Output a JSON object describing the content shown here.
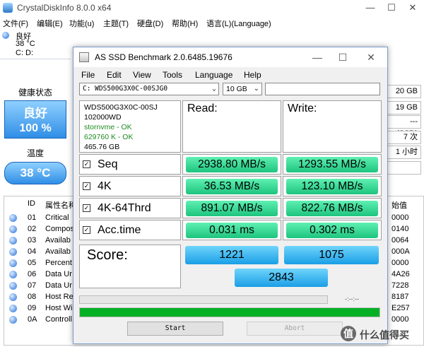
{
  "cdi": {
    "title": "CrystalDiskInfo 8.0.0 x64",
    "menu": [
      "文件(F)",
      "编辑(E)",
      "功能(u)",
      "主题(T)",
      "硬盘(D)",
      "帮助(H)",
      "语言(L)(Language)"
    ],
    "disk_tab": {
      "status": "良好",
      "temp": "38 °C",
      "letter": "C: D:"
    },
    "health_label": "健康状态",
    "health_status": "良好",
    "health_percent": "100 %",
    "temp_label": "温度",
    "temperature": "38 °C",
    "right_values": [
      "20 GB",
      "19 GB",
      "--- (SSD)",
      "7 次",
      "1 小时",
      ""
    ],
    "table": {
      "headers": {
        "id": "ID",
        "name": "属性名称",
        "raw": "始值"
      },
      "rows": [
        {
          "id": "01",
          "name": "Critical",
          "raw": "0000"
        },
        {
          "id": "02",
          "name": "Compos",
          "raw": "0140"
        },
        {
          "id": "03",
          "name": "Availab",
          "raw": "0064"
        },
        {
          "id": "04",
          "name": "Availab",
          "raw": "000A"
        },
        {
          "id": "05",
          "name": "Percent",
          "raw": "0000"
        },
        {
          "id": "06",
          "name": "Data Ur",
          "raw": "4A26"
        },
        {
          "id": "07",
          "name": "Data Ur",
          "raw": "7228"
        },
        {
          "id": "08",
          "name": "Host Re",
          "raw": "8187"
        },
        {
          "id": "09",
          "name": "Host Wi",
          "raw": "E257"
        },
        {
          "id": "0A",
          "name": "Controll",
          "raw": "0000"
        }
      ]
    }
  },
  "asssd": {
    "title": "AS SSD Benchmark 2.0.6485.19676",
    "window_buttons": {
      "minimize": "—",
      "maximize": "☐",
      "close": "✕"
    },
    "menu": [
      "File",
      "Edit",
      "View",
      "Tools",
      "Language",
      "Help"
    ],
    "drive_select": "C: WDS500G3X0C-00SJG0",
    "size_select": "10 GB",
    "info": {
      "model": "WDS500G3X0C-00SJ",
      "firmware": "102000WD",
      "driver": "stornvme - OK",
      "alignment": "629760 K - OK",
      "capacity": "465.76 GB"
    },
    "read_header": "Read:",
    "write_header": "Write:",
    "tests": [
      {
        "name": "Seq",
        "checked": "☑",
        "read": "2938.80 MB/s",
        "write": "1293.55 MB/s"
      },
      {
        "name": "4K",
        "checked": "☑",
        "read": "36.53 MB/s",
        "write": "123.10 MB/s"
      },
      {
        "name": "4K-64Thrd",
        "checked": "☑",
        "read": "891.07 MB/s",
        "write": "822.76 MB/s"
      },
      {
        "name": "Acc.time",
        "checked": "☑",
        "read": "0.031 ms",
        "write": "0.302 ms"
      }
    ],
    "score_label": "Score:",
    "score": {
      "read": "1221",
      "write": "1075",
      "total": "2843"
    },
    "elapsed": "-:--:--",
    "progress_total_fraction": 1.0,
    "start_button": "Start",
    "abort_button": "Abort"
  },
  "watermark": {
    "logo": "值",
    "text": "什么值得买"
  },
  "colors": {
    "result_green": "#1ec47e",
    "score_blue": "#1a9fe6",
    "progress_green": "#06b025",
    "ok_text": "#1e8a1e"
  }
}
